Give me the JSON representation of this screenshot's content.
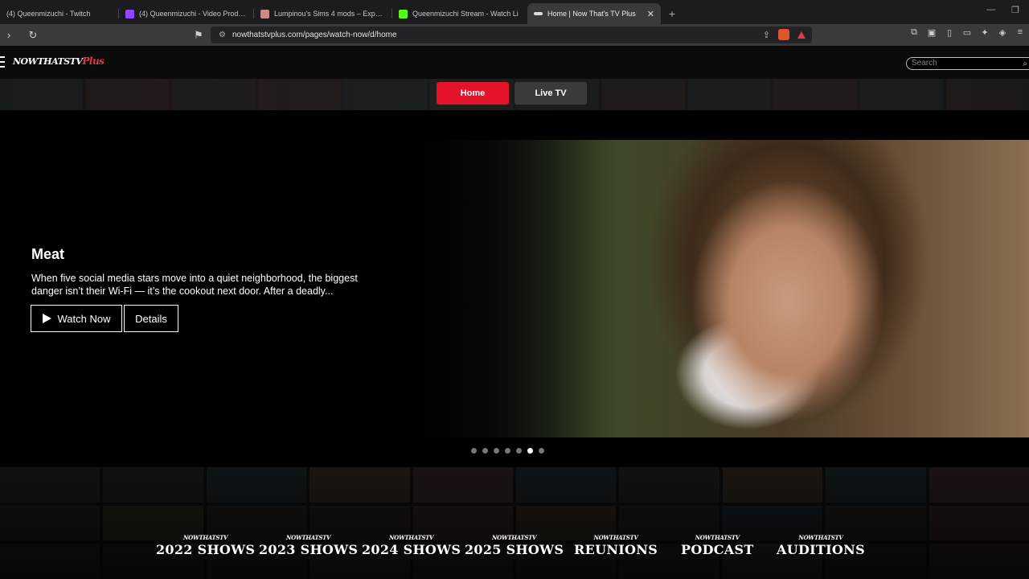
{
  "browser": {
    "tabs": [
      {
        "title": "(4) Queenmizuchi - Twitch",
        "favicon_color": "#9146ff",
        "active": false
      },
      {
        "title": "(4) Queenmizuchi - Video Producer -",
        "favicon_color": "#9146ff",
        "active": false
      },
      {
        "title": "Lumpinou's Sims 4 mods – Expandin",
        "favicon_color": "#c98a8a",
        "active": false
      },
      {
        "title": "Queenmizuchi Stream - Watch Li",
        "favicon_color": "#53fc18",
        "active": false
      },
      {
        "title": "Home | Now That's TV Plus",
        "favicon_color": "#dddddd",
        "active": true
      }
    ],
    "new_tab_label": "+",
    "url": "nowthatstvplus.com/pages/watch-now/d/home"
  },
  "site": {
    "logo_main": "NOWTHATSTV",
    "logo_plus": "Plus",
    "search_placeholder": "Search",
    "nav": [
      {
        "label": "Home",
        "active": true
      },
      {
        "label": "Live TV",
        "active": false
      }
    ]
  },
  "hero": {
    "title": "Meat",
    "description": "When five social media stars move into a quiet neighborhood, the biggest danger isn’t their Wi-Fi — it’s the cookout next door. After a deadly...",
    "watch_label": "Watch Now",
    "details_label": "Details",
    "slides_total": 7,
    "active_slide": 6
  },
  "categories": [
    {
      "brand": "NOWTHATSTV",
      "label": "2022 SHOWS"
    },
    {
      "brand": "NOWTHATSTV",
      "label": "2023 SHOWS"
    },
    {
      "brand": "NOWTHATSTV",
      "label": "2024 SHOWS"
    },
    {
      "brand": "NOWTHATSTV",
      "label": "2025 SHOWS"
    },
    {
      "brand": "NOWTHATSTV",
      "label": "REUNIONS"
    },
    {
      "brand": "NOWTHATSTV",
      "label": "PODCAST"
    },
    {
      "brand": "NOWTHATSTV",
      "label": "AUDITIONS"
    }
  ],
  "colors": {
    "accent": "#e5142a",
    "nav_inactive": "#3a3a3a"
  }
}
